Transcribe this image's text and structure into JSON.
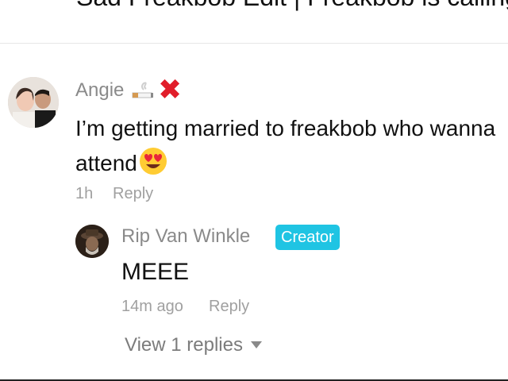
{
  "video": {
    "title": "Sad Freakbob Edit | Freakbob is calling."
  },
  "comment": {
    "username": "Angie",
    "text": "I’m getting married to freakbob who wanna attend",
    "time": "1h",
    "reply_label": "Reply"
  },
  "reply": {
    "username": "Rip Van Winkle",
    "badge": "Creator",
    "text": "MEEE",
    "time": "14m ago",
    "reply_label": "Reply"
  },
  "view_replies": {
    "label": "View 1 replies"
  },
  "icons": {
    "username_decoration_1": "cigarette-icon",
    "username_decoration_2": "red-x-icon",
    "comment_emoji": "heart-eyes-emoji",
    "expand": "chevron-down-icon"
  },
  "colors": {
    "badge": "#1fc4e3",
    "username": "#8a8a8a",
    "meta": "#a0a0a0",
    "x_mark": "#e11d2a"
  }
}
